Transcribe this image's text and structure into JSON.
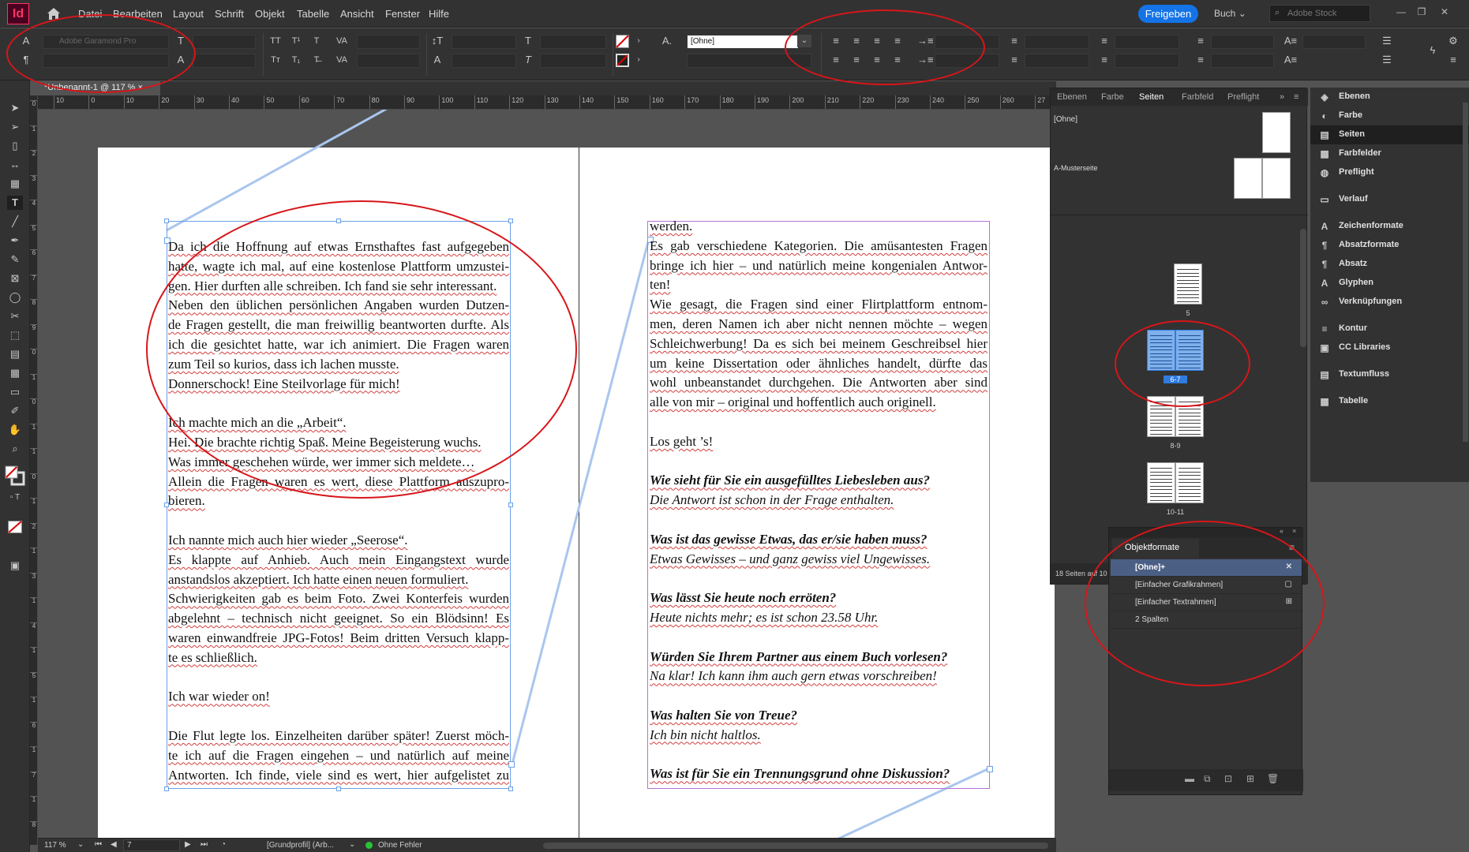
{
  "app": {
    "logo": "Id"
  },
  "menu": [
    "Datei",
    "Bearbeiten",
    "Layout",
    "Schrift",
    "Objekt",
    "Tabelle",
    "Ansicht",
    "Fenster",
    "Hilfe"
  ],
  "header": {
    "share": "Freigeben",
    "workspace": "Buch",
    "stock_placeholder": "Adobe Stock"
  },
  "control": {
    "font_family": "Adobe Garamond Pro",
    "char_style": "[Ohne]"
  },
  "document": {
    "tab_title": "*Unbenannt-1 @ 117 %",
    "close": "×"
  },
  "ruler_h": [
    "10",
    "0",
    "10",
    "20",
    "30",
    "40",
    "50",
    "60",
    "70",
    "80",
    "90",
    "100",
    "110",
    "120",
    "130",
    "140",
    "150",
    "160",
    "170",
    "180",
    "190",
    "200",
    "210",
    "220",
    "230",
    "240",
    "250",
    "260",
    "27"
  ],
  "ruler_v": [
    "0",
    "1",
    "2",
    "3",
    "4",
    "5",
    "6",
    "7",
    "8",
    "9",
    "0",
    "1",
    "0",
    "1",
    "1",
    "0",
    "1",
    "2",
    "1",
    "3",
    "1",
    "4",
    "1",
    "5",
    "1",
    "6",
    "1",
    "7",
    "1",
    "8"
  ],
  "left_page_text": [
    "Da ich die Hoffnung auf etwas Ernsthaftes fast aufgegeben",
    "hatte, wagte ich mal, auf eine kostenlose Plattform umzustei-",
    "gen. Hier durften alle schreiben. Ich fand sie sehr interessant.",
    "Neben den üblichen persönlichen Angaben wurden Dutzen-",
    "de Fragen gestellt, die man freiwillig beantworten durfte. Als",
    "ich die gesichtet hatte, war ich animiert. Die Fragen waren",
    "zum Teil so kurios, dass ich lachen musste.",
    "Donnerschock! Eine Steilvorlage für mich!",
    "",
    "Ich machte mich an die „Arbeit“.",
    "Hei. Die brachte richtig Spaß. Meine Begeisterung wuchs.",
    "Was immer geschehen würde, wer immer sich meldete…",
    "Allein die Fragen waren es wert, diese Plattform auszupro-",
    "bieren.",
    "",
    "Ich nannte mich auch hier wieder „Seerose“.",
    "Es klappte auf Anhieb. Auch mein Eingangstext wurde",
    "anstandslos akzeptiert. Ich hatte einen neuen formuliert.",
    "Schwierigkeiten gab es beim Foto. Zwei Konterfeis wurden",
    "abgelehnt – technisch nicht geeignet. So ein Blödsinn! Es",
    "waren einwandfreie JPG-Fotos! Beim dritten Versuch klapp-",
    "te es schließlich.",
    "",
    "Ich war wieder on!",
    "",
    "Die Flut legte los. Einzelheiten darüber später! Zuerst möch-",
    "te ich auf die Fragen eingehen – und natürlich auf meine",
    "Antworten. Ich finde, viele sind es wert, hier aufgelistet zu"
  ],
  "right_page_text": [
    {
      "t": "werden.",
      "s": "last"
    },
    {
      "t": "Es gab verschiedene Kategorien. Die amüsantesten Fragen",
      "s": ""
    },
    {
      "t": "bringe ich hier – und natürlich meine kongenialen Antwor-",
      "s": ""
    },
    {
      "t": "ten!",
      "s": "last"
    },
    {
      "t": "Wie gesagt, die Fragen sind einer Flirtplattform entnom-",
      "s": ""
    },
    {
      "t": "men, deren Namen ich aber nicht nennen möchte – wegen",
      "s": ""
    },
    {
      "t": "Schleichwerbung! Da es sich bei meinem Geschreibsel hier",
      "s": ""
    },
    {
      "t": "um keine Dissertation oder ähnliches handelt, dürfte das",
      "s": ""
    },
    {
      "t": "wohl unbeanstandet durchgehen. Die Antworten aber sind",
      "s": ""
    },
    {
      "t": "alle von mir – original und hoffentlich auch originell.",
      "s": "last"
    },
    {
      "t": "",
      "s": "blank"
    },
    {
      "t": "Los geht ’s!",
      "s": "last"
    },
    {
      "t": "",
      "s": "blank"
    },
    {
      "t": "Wie sieht für Sie ein ausgefülltes Liebesleben aus?",
      "s": "q"
    },
    {
      "t": "Die Antwort ist schon in der Frage enthalten.",
      "s": "a"
    },
    {
      "t": "",
      "s": "blank"
    },
    {
      "t": "Was ist das gewisse Etwas, das er/sie haben muss?",
      "s": "q"
    },
    {
      "t": "Etwas Gewisses – und ganz gewiss viel Ungewisses.",
      "s": "a"
    },
    {
      "t": "",
      "s": "blank"
    },
    {
      "t": "Was lässt Sie heute noch erröten?",
      "s": "q"
    },
    {
      "t": "Heute nichts mehr; es ist schon 23.58 Uhr.",
      "s": "a"
    },
    {
      "t": "",
      "s": "blank"
    },
    {
      "t": "Würden Sie Ihrem Partner aus einem Buch vorlesen?",
      "s": "q"
    },
    {
      "t": "Na klar! Ich kann ihm auch gern etwas vorschreiben!",
      "s": "a"
    },
    {
      "t": "",
      "s": "blank"
    },
    {
      "t": "Was halten Sie von Treue?",
      "s": "q"
    },
    {
      "t": "Ich bin nicht haltlos.",
      "s": "a"
    },
    {
      "t": "",
      "s": "blank"
    },
    {
      "t": "Was ist für Sie ein Trennungsgrund ohne Diskussion?",
      "s": "q"
    }
  ],
  "pages_panel": {
    "tabs": [
      "Ebenen",
      "Farbe",
      "Seiten",
      "Farbfeld",
      "Preflight"
    ],
    "none_label": "[Ohne]",
    "master_label": "A-Musterseite",
    "spreads": [
      "5",
      "6-7",
      "8-9",
      "10-11"
    ],
    "footer": "18 Seiten auf 10",
    "footer_style": "[Ohne]+"
  },
  "side_panels": [
    {
      "label": "Ebenen",
      "icon": "layers-icon",
      "glyph": "◈"
    },
    {
      "label": "Farbe",
      "icon": "color-icon",
      "glyph": "◐"
    },
    {
      "label": "Seiten",
      "icon": "pages-icon",
      "glyph": "▤"
    },
    {
      "label": "Farbfelder",
      "icon": "swatches-icon",
      "glyph": "▦"
    },
    {
      "label": "Preflight",
      "icon": "preflight-icon",
      "glyph": "◍"
    },
    {
      "label": "Verlauf",
      "icon": "gradient-icon",
      "glyph": "▭"
    },
    {
      "label": "Zeichenformate",
      "icon": "char-styles-icon",
      "glyph": "A"
    },
    {
      "label": "Absatzformate",
      "icon": "para-styles-icon",
      "glyph": "¶"
    },
    {
      "label": "Absatz",
      "icon": "paragraph-icon",
      "glyph": "¶"
    },
    {
      "label": "Glyphen",
      "icon": "glyphs-icon",
      "glyph": "A"
    },
    {
      "label": "Verknüpfungen",
      "icon": "links-icon",
      "glyph": "∞"
    },
    {
      "label": "Kontur",
      "icon": "stroke-icon",
      "glyph": "≡"
    },
    {
      "label": "CC Libraries",
      "icon": "libraries-icon",
      "glyph": "▣"
    },
    {
      "label": "Textumfluss",
      "icon": "text-wrap-icon",
      "glyph": "▤"
    },
    {
      "label": "Tabelle",
      "icon": "table-icon",
      "glyph": "▦"
    }
  ],
  "object_styles": {
    "title": "Objektformate",
    "items": [
      "[Ohne]+",
      "[Einfacher Grafikrahmen]",
      "[Einfacher Textrahmen]",
      "2 Spalten"
    ]
  },
  "status": {
    "zoom": "117 %",
    "page": "7",
    "profile": "[Grundprofil] (Arb...",
    "preflight": "Ohne Fehler"
  },
  "colors": {
    "accent": "#1473e6",
    "annotation": "#d7161a",
    "frame_blue": "#6aa0e8",
    "frame_purple": "#b473d4"
  }
}
